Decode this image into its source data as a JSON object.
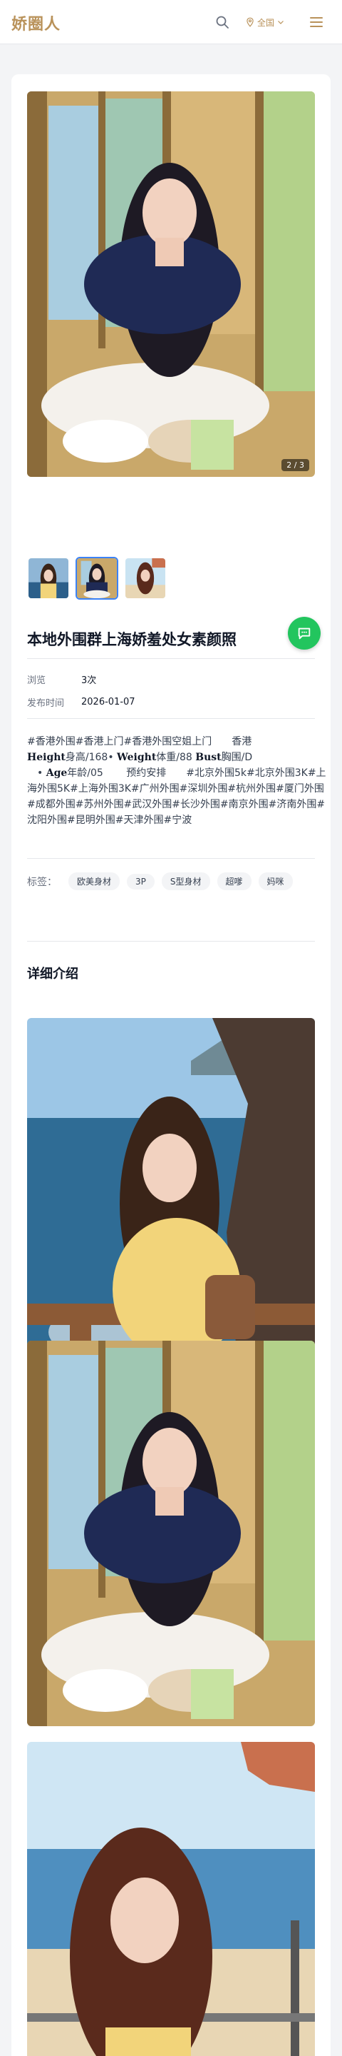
{
  "header": {
    "logo": "娇圈人",
    "region_label": "全国",
    "icons": [
      "search-icon",
      "location-pin-icon",
      "chevron-down-icon",
      "menu-icon"
    ]
  },
  "gallery": {
    "counter": "2 / 3",
    "thumb_count": 3,
    "active_thumb": 2
  },
  "post": {
    "title": "本地外围群上海娇羞处女素颜照",
    "views_label": "浏览",
    "views_value": "3次",
    "date_label": "发布时间",
    "date_value": "2026-01-07",
    "desc_line1": "#香港外围#香港上门#香港外围空姐上门　　香港",
    "height_key": "Height",
    "height_val": "身高/168•",
    "weight_key": "Weight",
    "weight_val": "体重/88",
    "bust_key": "Bust",
    "bust_val": "胸围/D",
    "age_prefix": "　•",
    "age_key": "Age",
    "age_val": "年龄/05　　 预约安排　　#北京外围5k#北京外围3K#上海外围5K#上海外围3K#广州外围#深圳外围#杭州外围#厦门外围#成都外围#苏州外围#武汉外围#长沙外围#南京外围#济南外围#沈阳外围#昆明外围#天津外围#宁波"
  },
  "tags": {
    "label": "标签：",
    "items": [
      "欧美身材",
      "3P",
      "S型身材",
      "超嗲",
      "妈咪"
    ]
  },
  "details": {
    "title": "详细介绍"
  },
  "colors": {
    "brand": "#b9925a",
    "chat": "#22c55e",
    "active_border": "#3b82f6"
  }
}
